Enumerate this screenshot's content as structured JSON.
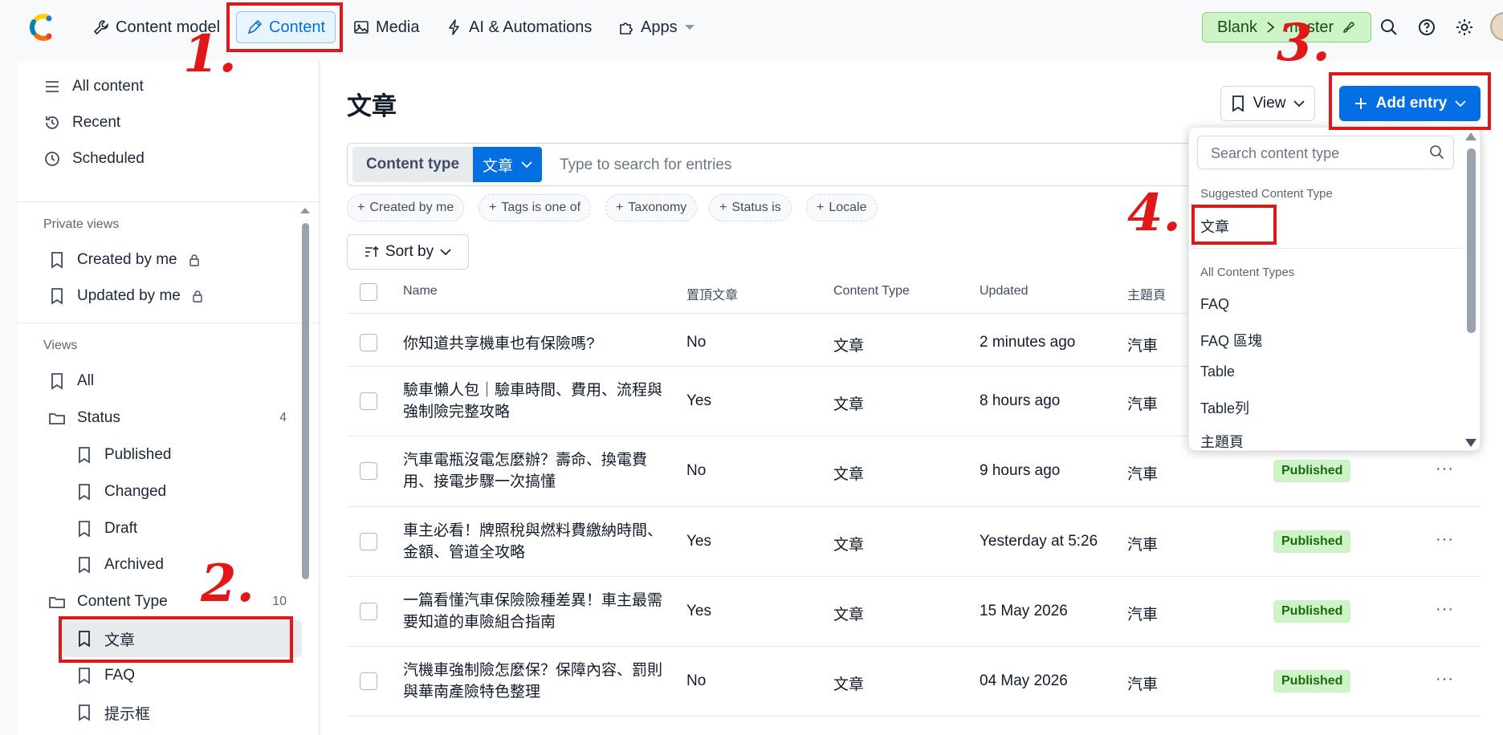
{
  "topnav": {
    "items": [
      {
        "label": "Content model",
        "icon": "wrench-icon"
      },
      {
        "label": "Content",
        "icon": "pen-icon",
        "active": true
      },
      {
        "label": "Media",
        "icon": "image-icon"
      },
      {
        "label": "AI & Automations",
        "icon": "lightning-icon"
      },
      {
        "label": "Apps",
        "icon": "puzzle-icon"
      }
    ],
    "env_space": "Blank",
    "env_branch": "master",
    "icons": [
      "search-icon",
      "help-icon",
      "gear-icon"
    ]
  },
  "sidebar": {
    "top_items": [
      {
        "label": "All content",
        "icon": "list-icon"
      },
      {
        "label": "Recent",
        "icon": "history-icon"
      },
      {
        "label": "Scheduled",
        "icon": "clock-icon"
      }
    ],
    "private_views_label": "Private views",
    "private_views": [
      {
        "label": "Created by me",
        "icon": "bookmark-icon"
      },
      {
        "label": "Updated by me",
        "icon": "bookmark-icon"
      }
    ],
    "views_label": "Views",
    "views_all": "All",
    "status_folder": {
      "label": "Status",
      "count": "4"
    },
    "status_items": [
      "Published",
      "Changed",
      "Draft",
      "Archived"
    ],
    "content_type_folder": {
      "label": "Content Type",
      "count": "10"
    },
    "content_type_items": [
      "文章",
      "FAQ",
      "提示框"
    ]
  },
  "main": {
    "title": "文章",
    "view_button": "View",
    "add_entry_button": "Add entry",
    "content_type_label": "Content type",
    "content_type_value": "文章",
    "search_placeholder": "Type to search for entries",
    "filter_chips": [
      "Created by me",
      "Tags is one of",
      "Taxonomy",
      "Status is",
      "Locale"
    ],
    "sort_button": "Sort by",
    "columns": [
      "Name",
      "置頂文章",
      "Content Type",
      "Updated",
      "主題頁"
    ],
    "rows": [
      {
        "name": "你知道共享機車也有保險嗎?",
        "pinned": "No",
        "type": "文章",
        "updated": "2 minutes ago",
        "topic": "汽車",
        "status": ""
      },
      {
        "name": "驗車懶人包｜驗車時間、費用、流程與強制險完整攻略",
        "pinned": "Yes",
        "type": "文章",
        "updated": "8 hours ago",
        "topic": "汽車",
        "status": ""
      },
      {
        "name": "汽車電瓶沒電怎麼辦？壽命、換電費用、接電步驟一次搞懂",
        "pinned": "No",
        "type": "文章",
        "updated": "9 hours ago",
        "topic": "汽車",
        "status": "Published"
      },
      {
        "name": "車主必看！牌照稅與燃料費繳納時間、金額、管道全攻略",
        "pinned": "Yes",
        "type": "文章",
        "updated": "Yesterday at 5:26",
        "topic": "汽車",
        "status": "Published"
      },
      {
        "name": "一篇看懂汽車保險險種差異！車主最需要知道的車險組合指南",
        "pinned": "Yes",
        "type": "文章",
        "updated": "15 May 2026",
        "topic": "汽車",
        "status": "Published"
      },
      {
        "name": "汽機車強制險怎麼保？保障內容、罰則與華南產險特色整理",
        "pinned": "No",
        "type": "文章",
        "updated": "04 May 2026",
        "topic": "汽車",
        "status": "Published"
      }
    ],
    "more_glyph": "···"
  },
  "dropdown": {
    "search_placeholder": "Search content type",
    "suggested_label": "Suggested Content Type",
    "suggested_items": [
      "文章"
    ],
    "all_label": "All Content Types",
    "all_items": [
      "FAQ",
      "FAQ 區塊",
      "Table",
      "Table列",
      "主題頁"
    ]
  },
  "annotations": [
    "1.",
    "2.",
    "3.",
    "4."
  ],
  "colors": {
    "accent": "#036fe3",
    "annotation": "#e01818",
    "published_bg": "#cdf3c6"
  }
}
